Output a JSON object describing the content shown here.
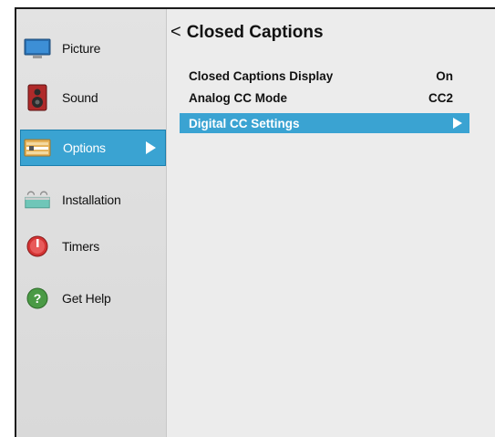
{
  "sidebar": {
    "items": [
      {
        "label": "Picture",
        "icon": "monitor-icon"
      },
      {
        "label": "Sound",
        "icon": "speaker-icon"
      },
      {
        "label": "Options",
        "icon": "options-icon"
      },
      {
        "label": "Installation",
        "icon": "installation-icon"
      },
      {
        "label": "Timers",
        "icon": "timer-icon"
      },
      {
        "label": "Get Help",
        "icon": "help-icon"
      }
    ],
    "selected": "Options"
  },
  "main": {
    "back_symbol": "<",
    "title": "Closed Captions",
    "rows": [
      {
        "name": "Closed Captions Display",
        "value": "On"
      },
      {
        "name": "Analog CC Mode",
        "value": "CC2"
      },
      {
        "name": "Digital CC Settings",
        "value": ""
      }
    ],
    "selected_row": "Digital CC Settings"
  },
  "colors": {
    "accent": "#3aa3d2",
    "background": "#ececec",
    "sidebar": "#dedede"
  }
}
